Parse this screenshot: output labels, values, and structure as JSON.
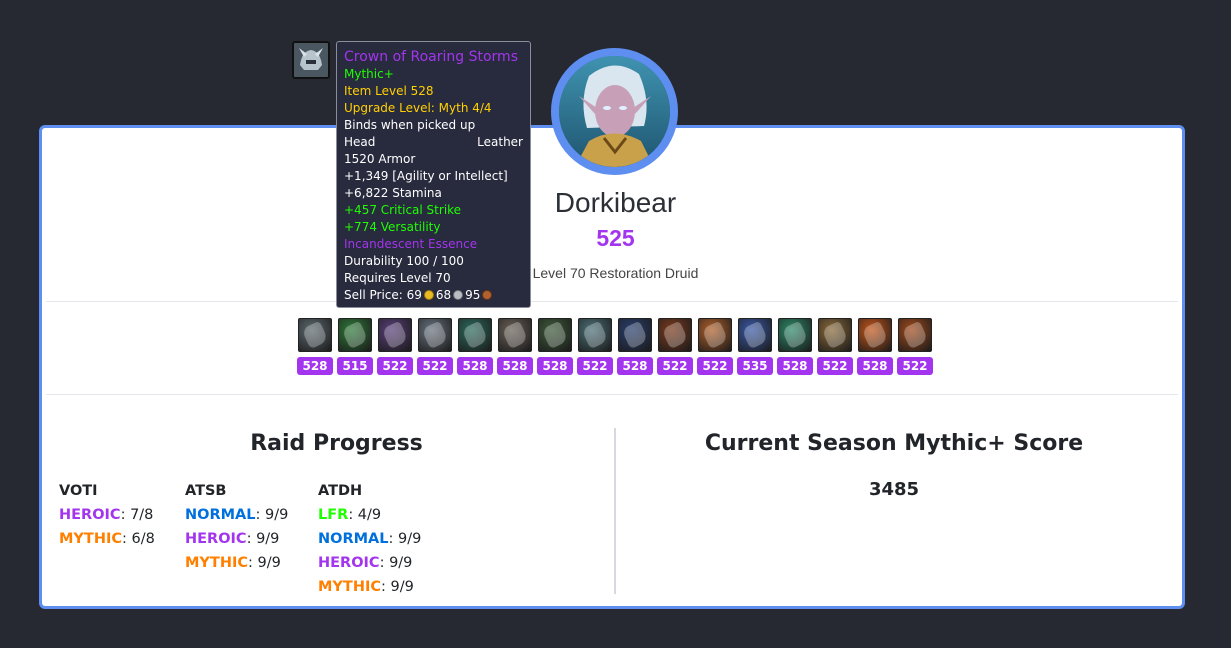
{
  "character": {
    "name": "Dorkibear",
    "item_level": "525",
    "description": "Level 70 Restoration Druid"
  },
  "tooltip": {
    "name": "Crown of Roaring Storms",
    "difficulty": "Mythic+",
    "item_level": "Item Level 528",
    "upgrade_level": "Upgrade Level: Myth 4/4",
    "binding": "Binds when picked up",
    "slot": "Head",
    "armor_type": "Leather",
    "armor": "1520 Armor",
    "primary_stat": "+1,349 [Agility or Intellect]",
    "stamina": "+6,822 Stamina",
    "secondary_1": "+457 Critical Strike",
    "secondary_2": "+774 Versatility",
    "enchant": "Incandescent Essence",
    "durability": "Durability 100 / 100",
    "requires": "Requires Level 70",
    "sell_label": "Sell Price: 69",
    "sell_silver": "68",
    "sell_copper": "95"
  },
  "gear": [
    {
      "ilvl": "528",
      "icon": "helm-icon",
      "color": "#5d6a70"
    },
    {
      "ilvl": "515",
      "icon": "necklace-icon",
      "color": "#2f7a3a"
    },
    {
      "ilvl": "522",
      "icon": "shoulders-icon",
      "color": "#5a3f7a"
    },
    {
      "ilvl": "522",
      "icon": "cloak-icon",
      "color": "#6a7380"
    },
    {
      "ilvl": "528",
      "icon": "chest-icon",
      "color": "#2c6a5c"
    },
    {
      "ilvl": "528",
      "icon": "wrist-icon",
      "color": "#6a6058"
    },
    {
      "ilvl": "528",
      "icon": "gloves-icon",
      "color": "#3d5a3a"
    },
    {
      "ilvl": "522",
      "icon": "belt-icon",
      "color": "#4c7078"
    },
    {
      "ilvl": "528",
      "icon": "legs-icon",
      "color": "#2a3f6e"
    },
    {
      "ilvl": "522",
      "icon": "boots-icon",
      "color": "#7a3a1e"
    },
    {
      "ilvl": "522",
      "icon": "ring-icon",
      "color": "#b0602a"
    },
    {
      "ilvl": "535",
      "icon": "ring-icon",
      "color": "#3a5aa8"
    },
    {
      "ilvl": "528",
      "icon": "trinket-icon",
      "color": "#2e8a6a"
    },
    {
      "ilvl": "522",
      "icon": "trinket-icon",
      "color": "#8a6a3a"
    },
    {
      "ilvl": "528",
      "icon": "weapon-icon",
      "color": "#c4561a"
    },
    {
      "ilvl": "522",
      "icon": "offhand-icon",
      "color": "#a04a1c"
    }
  ],
  "raid_progress": {
    "title": "Raid Progress",
    "raids": [
      {
        "name": "VOTI",
        "rows": [
          {
            "difficulty": "HEROIC",
            "value": ": 7/8"
          },
          {
            "difficulty": "MYTHIC",
            "value": ": 6/8"
          }
        ]
      },
      {
        "name": "ATSB",
        "rows": [
          {
            "difficulty": "NORMAL",
            "value": ": 9/9"
          },
          {
            "difficulty": "HEROIC",
            "value": ": 9/9"
          },
          {
            "difficulty": "MYTHIC",
            "value": ": 9/9"
          }
        ]
      },
      {
        "name": "ATDH",
        "rows": [
          {
            "difficulty": "LFR",
            "value": ": 4/9"
          },
          {
            "difficulty": "NORMAL",
            "value": ": 9/9"
          },
          {
            "difficulty": "HEROIC",
            "value": ": 9/9"
          },
          {
            "difficulty": "MYTHIC",
            "value": ": 9/9"
          }
        ]
      }
    ]
  },
  "mythic_plus": {
    "title": "Current Season Mythic+ Score",
    "score": "3485"
  },
  "colors": {
    "accent": "#5d8ef0",
    "epic": "#a335ee",
    "legendary": "#ff8000",
    "uncommon": "#1eff00",
    "rare": "#0070dd",
    "background": "#262932"
  }
}
